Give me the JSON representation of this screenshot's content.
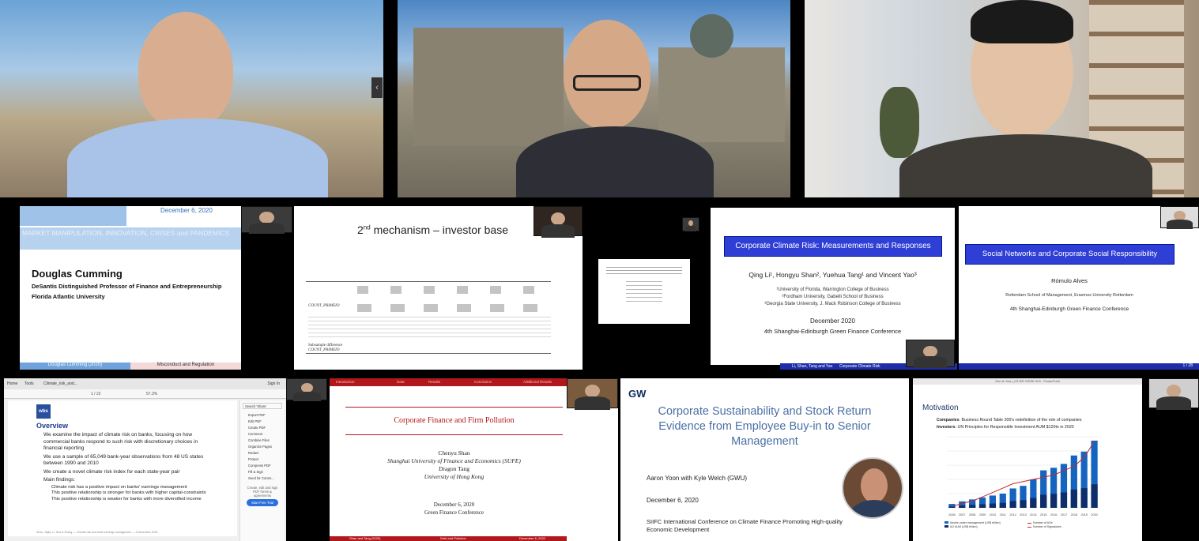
{
  "row2": {
    "t1": {
      "date": "December 6, 2020",
      "session": "MARKET MANIPULATION, INNOVATION, CRISES and PANDEMICS",
      "name": "Douglas Cumming",
      "title": "DeSantis Distinguished Professor of Finance and Entrepreneurship",
      "affiliation": "Florida Atlantic University",
      "footer_left": "Douglas Cumming (2020)",
      "footer_right": "Misconduct and Regulation"
    },
    "t2": {
      "title_prefix": "2",
      "title_sup": "nd",
      "title_rest": " mechanism – investor base",
      "row_label": "COUNT_PRIMEIO",
      "footer1": "Subsample difference",
      "footer2": "COUNT_PRIMEIO"
    },
    "t4": {
      "title": "Corporate Climate Risk: Measurements and Responses",
      "authors": "Qing Li¹, Hongyu Shan², Yuehua Tang¹ and Vincent Yao³",
      "aff1": "¹University of Florida, Warrington College of Business",
      "aff2": "²Fordham University, Gabelli School of Business",
      "aff3": "³Georgia State University, J. Mack Robinson College of Business",
      "date": "December 2020",
      "conf": "4th Shanghai-Edinburgh Green Finance Conference",
      "footer_left": "Li, Shan, Tang and Yao",
      "footer_mid": "Corporate Climate Risk"
    },
    "t5": {
      "title": "Social Networks and Corporate Social Responsibility",
      "author": "Rómulo Alves",
      "affiliation": "Rotterdam School of Management, Erasmus University Rotterdam",
      "conf": "4th Shanghai-Edinburgh Green Finance Conference",
      "page": "1 / 28"
    }
  },
  "row3": {
    "t1": {
      "menu_home": "Home",
      "menu_tools": "Tools",
      "tab": "Climate_risk_and...",
      "sign_in": "Sign In",
      "zoom": "57.3%",
      "pages": "1 / 22",
      "heading": "Overview",
      "bullets": [
        "We examine the impact of climate risk on banks, focusing on how commercial banks respond to such risk with discretionary choices in financial reporting",
        "We use a sample of 65,049 bank-year observations from 48 US states between 1990 and 2010",
        "We create a novel climate risk index for each state-year pair",
        "Main findings:"
      ],
      "sub_bullets": [
        "Climate risk has a positive impact on banks' earnings management",
        "This positive relationship is stronger for banks with higher capital-constraints",
        "This positive relationship is weaker for banks with more diversified income"
      ],
      "footer": "Shao, Jiajia, Li, Hua & Zhang — Climate risk and bank earnings management — 6 December 2020",
      "sidebar_search": "Search 'Share'",
      "sidebar_items": [
        "Export PDF",
        "Edit PDF",
        "Create PDF",
        "Comment",
        "Combine Files",
        "Organize Pages",
        "Redact",
        "Protect",
        "Compress PDF",
        "Fill & Sign",
        "Send for Comm..."
      ],
      "trial_text": "Create, edit and sign PDF forms & agreements",
      "trial_button": "Start Free Trial"
    },
    "t2": {
      "title": "Corporate Finance and Firm Pollution",
      "author1": "Chenyu Shan",
      "aff1": "Shanghai University of Finance and Economics (SUFE)",
      "author2": "Dragon Tang",
      "aff2": "University of Hong Kong",
      "date": "December 6, 2020",
      "conf": "Green Finance Conference",
      "nav": [
        "Introduction",
        "Data",
        "Results",
        "Conclusion",
        "Additional Results"
      ],
      "footer_left": "Shan and Tang (2020)",
      "footer_mid": "Debt and Pollution",
      "footer_right": "December 6, 2020"
    },
    "t3": {
      "logo": "GW",
      "title": "Corporate Sustainability and Stock Return Evidence from Employee Buy-in to Senior Management",
      "authors": "Aaron Yoon with Kyle Welch (GWU)",
      "date": "December 6, 2020",
      "conf": "SIIFC International Conference on Climate Finance Promoting High-quality Economic Development"
    },
    "t4": {
      "window_title": "Gen & Yoon_CS-RR CRISE W.5 - PowerPoint",
      "heading": "Motivation",
      "line1_bold": "Companies",
      "line1": ": Business Round Table 200's redefinition of the role of companies",
      "line2_bold": "Investors",
      "line2": ": UN Principles for Responsible Investment AUM $120tn in 2020",
      "legend1": "Assets under management (US$ trillion)",
      "legend2": "AO AUM (US$ trillion)",
      "legend3": "Number of AOs",
      "legend4": "Number of Signatories"
    }
  },
  "chart_data": {
    "type": "bar",
    "categories": [
      "2006",
      "2007",
      "2008",
      "2009",
      "2010",
      "2011",
      "2012",
      "2013",
      "2014",
      "2015",
      "2016",
      "2017",
      "2018",
      "2019",
      "2020"
    ],
    "series": [
      {
        "name": "Assets under management (US$ trillion)",
        "values": [
          6,
          10,
          13,
          16,
          19,
          22,
          30,
          34,
          44,
          58,
          62,
          68,
          81,
          87,
          104
        ]
      },
      {
        "name": "Number of Signatories",
        "values": [
          63,
          200,
          310,
          500,
          700,
          900,
          1100,
          1200,
          1300,
          1400,
          1500,
          1700,
          1900,
          2300,
          3038
        ]
      }
    ]
  }
}
